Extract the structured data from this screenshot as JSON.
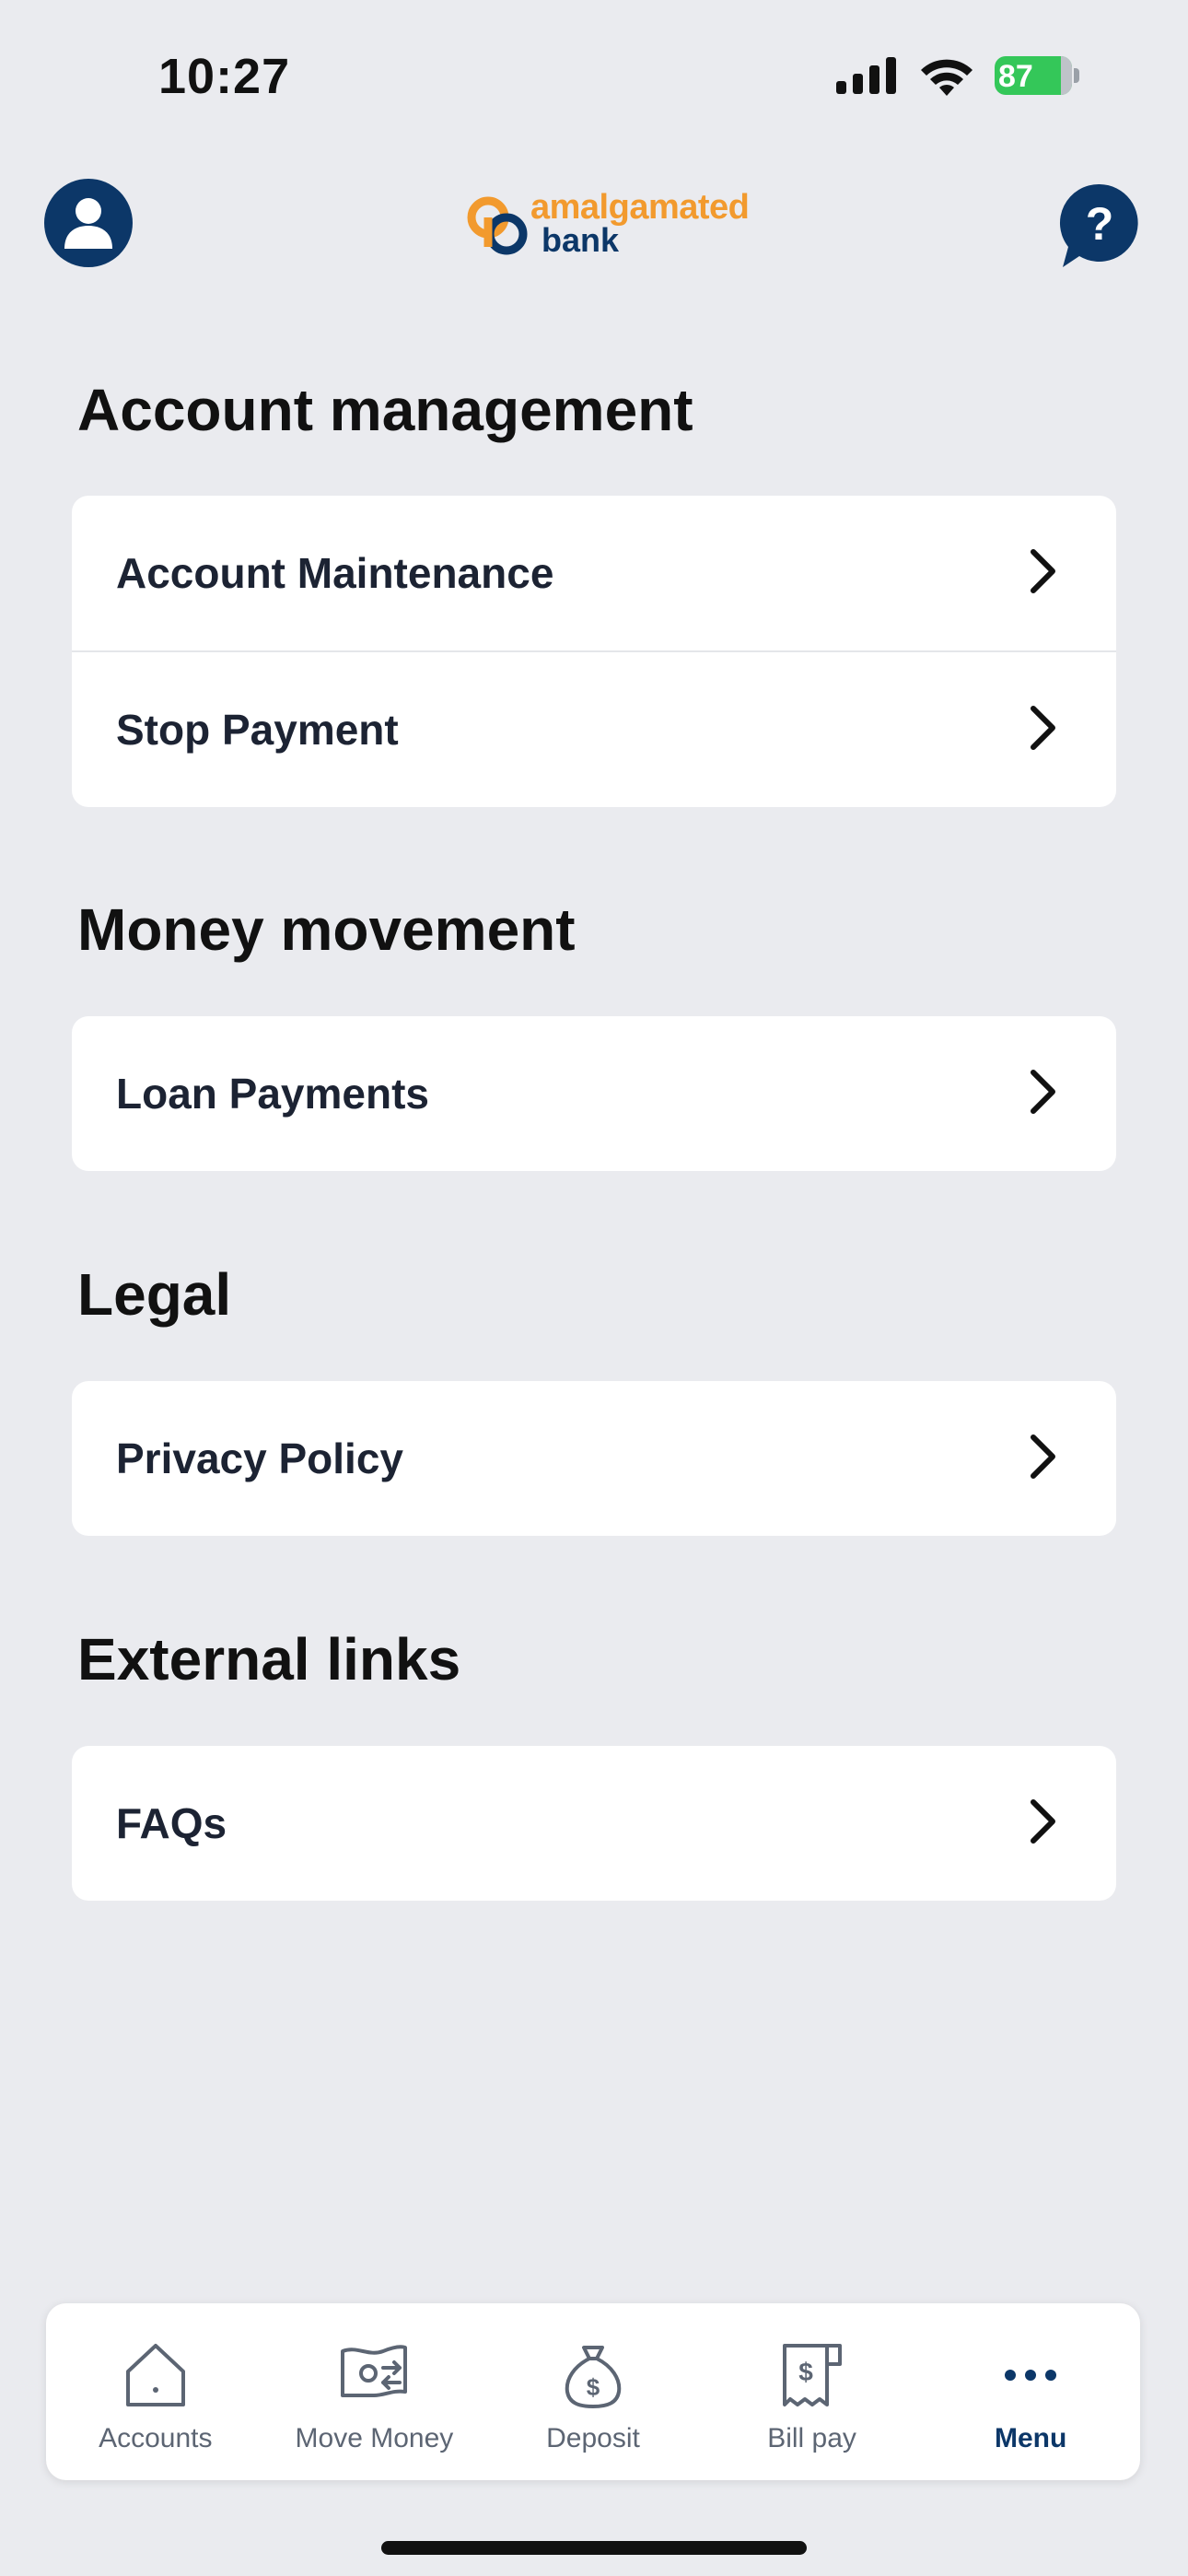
{
  "status_bar": {
    "time": "10:27",
    "battery": "87"
  },
  "header": {
    "logo_top": "amalgamated",
    "logo_bottom": "bank",
    "brand_colors": {
      "orange": "#f29a2e",
      "navy": "#0c3768"
    }
  },
  "sections": [
    {
      "title": "Account management",
      "items": [
        {
          "label": "Account Maintenance"
        },
        {
          "label": "Stop Payment"
        }
      ]
    },
    {
      "title": "Money movement",
      "items": [
        {
          "label": "Loan Payments"
        }
      ]
    },
    {
      "title": "Legal",
      "items": [
        {
          "label": "Privacy Policy"
        }
      ]
    },
    {
      "title": "External links",
      "items": [
        {
          "label": "FAQs"
        }
      ]
    }
  ],
  "tabbar": {
    "tabs": [
      {
        "label": "Accounts",
        "icon": "home-icon"
      },
      {
        "label": "Move Money",
        "icon": "money-transfer-icon"
      },
      {
        "label": "Deposit",
        "icon": "money-bag-icon"
      },
      {
        "label": "Bill pay",
        "icon": "bill-icon"
      },
      {
        "label": "Menu",
        "icon": "more-dots-icon",
        "active": true
      }
    ]
  }
}
